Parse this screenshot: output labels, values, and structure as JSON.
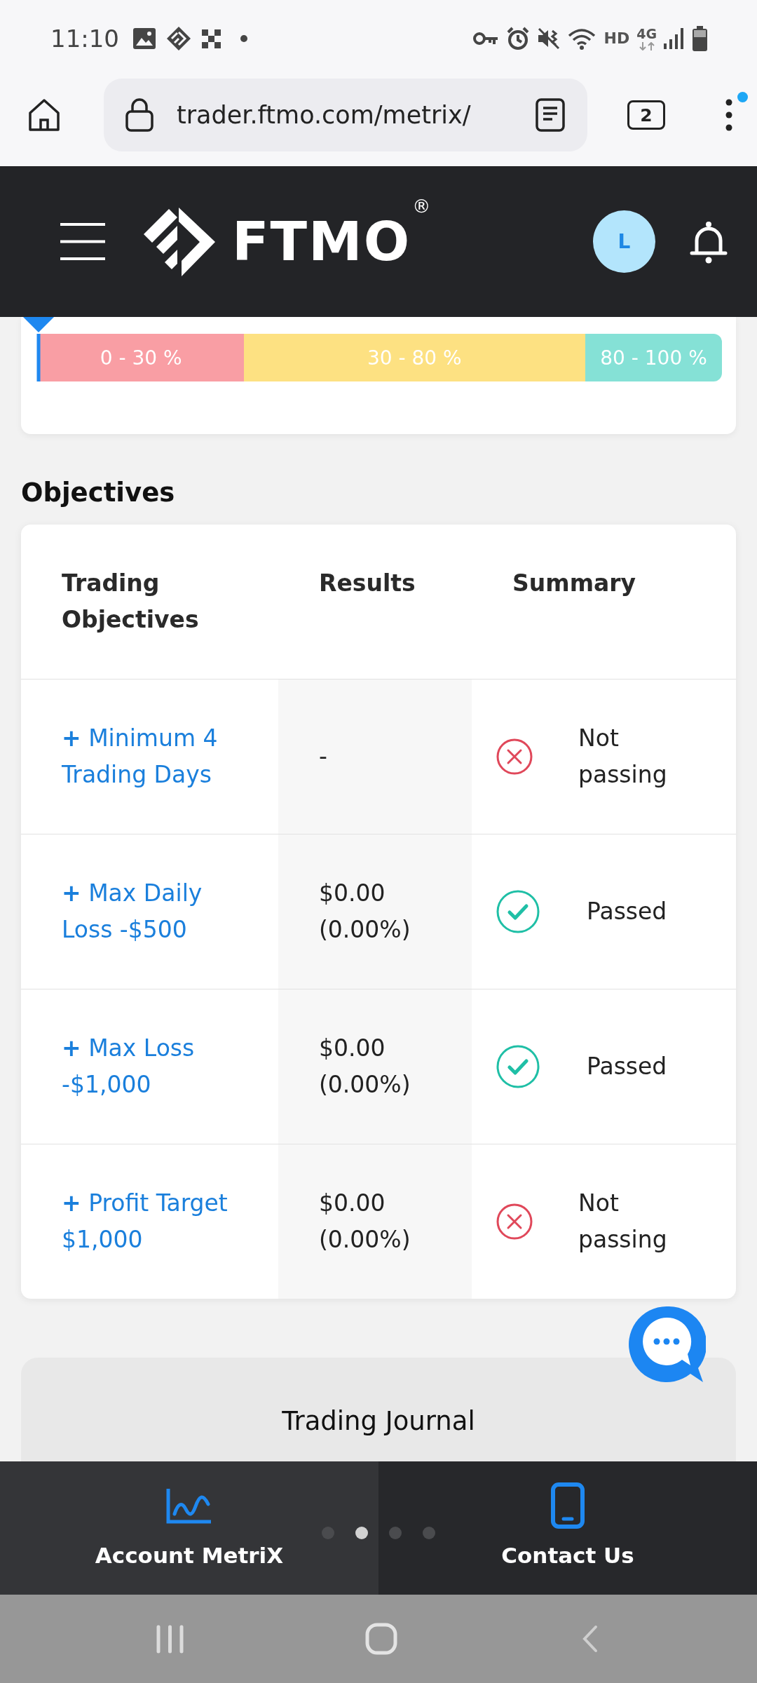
{
  "status_bar": {
    "time": "11:10",
    "network_labels": [
      {
        "text": "HD",
        "kind": "plain"
      },
      {
        "text": "4G",
        "kind": "data"
      }
    ]
  },
  "browser": {
    "url": "trader.ftmo.com/metrix/",
    "tab_count": "2",
    "menu_badge": true
  },
  "header": {
    "logo_text": "FTMO",
    "logo_symbol": "®",
    "avatar_initial": "L"
  },
  "gauge": {
    "level": 0,
    "segments": [
      {
        "label": "0 - 30 %",
        "color": "#f99ea4"
      },
      {
        "label": "30 - 80 %",
        "color": "#fde182"
      },
      {
        "label": "80 - 100 %",
        "color": "#85e1d6"
      }
    ]
  },
  "objectives": {
    "title": "Objectives",
    "columns": [
      "Trading Objectives",
      "Results",
      "Summary"
    ],
    "rows": [
      {
        "objective": "**+** Minimum 4 Trading Days",
        "result": "-",
        "summary": "Not passing",
        "passed": false
      },
      {
        "objective": "**+** Max Daily Loss -$500",
        "result": "$0.00 (0.00%)",
        "summary": "Passed",
        "passed": true
      },
      {
        "objective": "**+** Max Loss -$1,000",
        "result": "$0.00 (0.00%)",
        "summary": "Passed",
        "passed": true
      },
      {
        "objective": "**+** Profit Target $1,000",
        "result": "$0.00 (0.00%)",
        "summary": "Not passing",
        "passed": false
      }
    ]
  },
  "trading_journal": {
    "title": "Trading Journal"
  },
  "bottom_nav": {
    "items": [
      {
        "label": "Account MetriX",
        "selected": true
      },
      {
        "label": "Contact Us",
        "selected": false
      }
    ],
    "pager": [
      {
        "selected": false
      },
      {
        "selected": true
      },
      {
        "selected": false
      },
      {
        "selected": false
      }
    ]
  }
}
